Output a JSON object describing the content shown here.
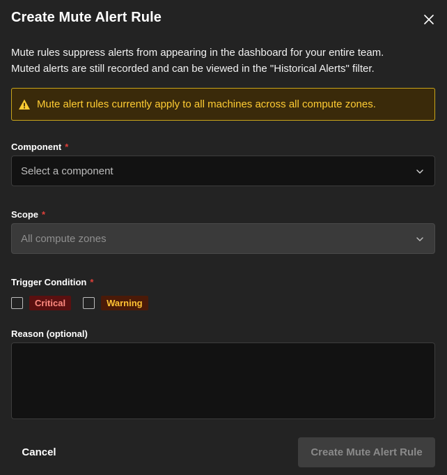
{
  "dialog": {
    "title": "Create Mute Alert Rule",
    "close_icon": "close-icon",
    "description_line1": "Mute rules suppress alerts from appearing in the dashboard for your entire team.",
    "description_line2": "Muted alerts are still recorded and can be viewed in the \"Historical Alerts\" filter."
  },
  "warning": {
    "icon": "warning-triangle-icon",
    "text": "Mute alert rules currently apply to all machines across all compute zones.",
    "color": "#ffcc33"
  },
  "component": {
    "label": "Component",
    "required_mark": "*",
    "placeholder": "Select a component",
    "icon": "chevron-down-icon"
  },
  "scope": {
    "label": "Scope",
    "required_mark": "*",
    "value": "All compute zones",
    "disabled": true,
    "icon": "chevron-down-icon"
  },
  "trigger": {
    "label": "Trigger Condition",
    "required_mark": "*",
    "options": [
      {
        "label": "Critical",
        "checked": false,
        "color": "#ff8a80"
      },
      {
        "label": "Warning",
        "checked": false,
        "color": "#ffc233"
      }
    ]
  },
  "reason": {
    "label": "Reason (optional)",
    "value": ""
  },
  "footer": {
    "cancel_label": "Cancel",
    "submit_label": "Create Mute Alert Rule",
    "submit_disabled": true
  },
  "colors": {
    "background": "#232323",
    "required": "#e0403a",
    "warning_border": "#c9a51a"
  }
}
